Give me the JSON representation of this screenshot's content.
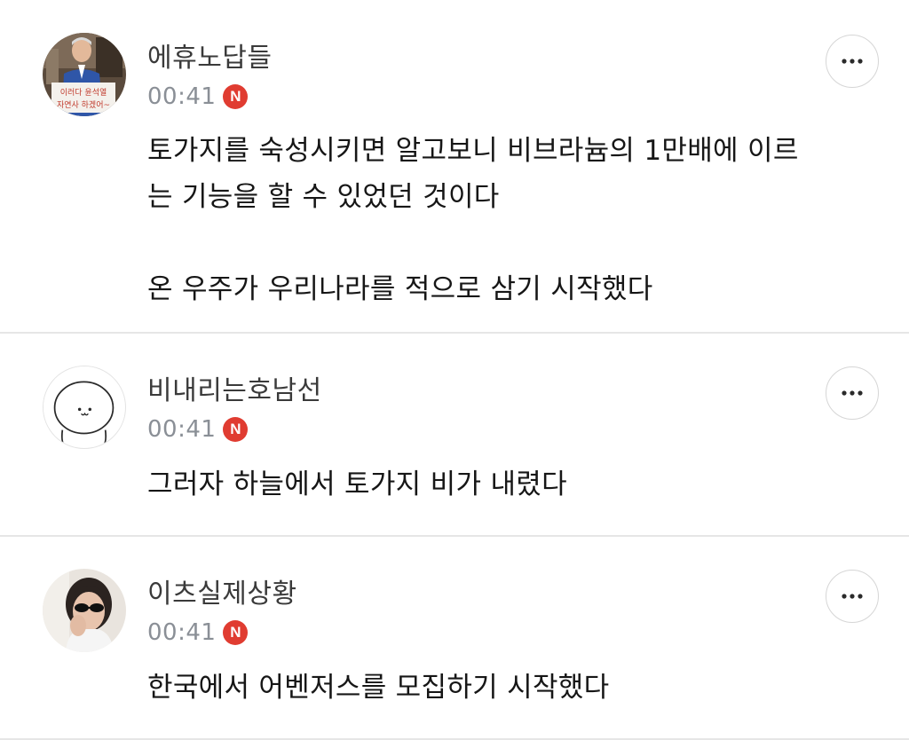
{
  "comments": [
    {
      "username": "에휴노답들",
      "time": "00:41",
      "badge": "N",
      "avatar_icon": "man-holding-protest-sign-photo",
      "avatar_sign_line1": "이러다 윤석열",
      "avatar_sign_line2": "자연사 하겠어~",
      "text_lines": [
        "토가지를 숙성시키면 알고보니 비브라늄의 1만배에 이르",
        "는 기능을 할 수 있었던 것이다",
        "",
        "온 우주가 우리나라를 적으로 삼기 시작했다"
      ]
    },
    {
      "username": "비내리는호남선",
      "time": "00:41",
      "badge": "N",
      "avatar_icon": "cartoon-face-avatar",
      "text_lines": [
        "그러자 하늘에서 토가지 비가 내렸다"
      ]
    },
    {
      "username": "이츠실제상황",
      "time": "00:41",
      "badge": "N",
      "avatar_icon": "woman-sunglasses-photo",
      "text_lines": [
        "한국에서 어벤저스를 모집하기 시작했다"
      ]
    }
  ],
  "more_icon": "more-horizontal-icon",
  "colors": {
    "badge": "#e03c31",
    "time": "#8a8f96",
    "divider": "#e6e6e6"
  }
}
